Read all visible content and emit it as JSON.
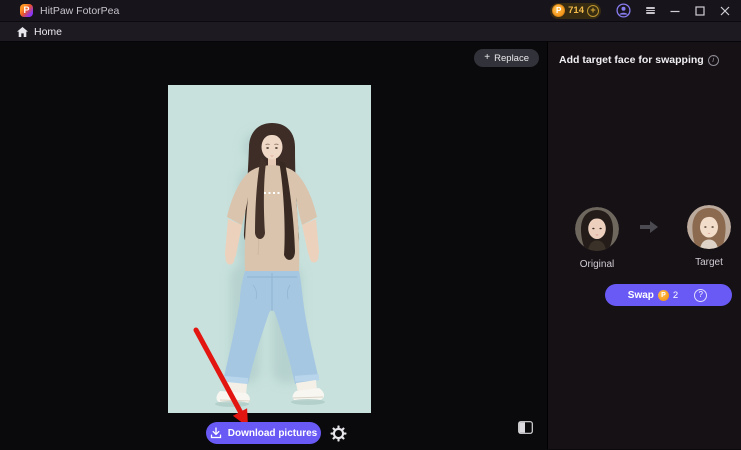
{
  "titlebar": {
    "app_name": "HitPaw FotorPea",
    "logo_letter": "P",
    "coin_letter": "P",
    "coin_count": "714",
    "plus": "+"
  },
  "nav": {
    "home_label": "Home"
  },
  "canvas": {
    "replace_button": {
      "plus": "+",
      "label": "Replace"
    },
    "download_button": {
      "label": "Download pictures"
    }
  },
  "panel": {
    "title": "Add target face for swapping",
    "info": "i",
    "original_label": "Original",
    "target_label": "Target",
    "swap_button": {
      "label": "Swap",
      "coin_letter": "P",
      "cost": "2",
      "help": "?"
    }
  },
  "colors": {
    "accent_purple": "#6a5af5",
    "coin_orange": "#f59a1c",
    "arrow_red": "#e31510",
    "photo_background_mint": "#c8e1dd",
    "titlebar_bg": "#18141c",
    "canvas_bg": "#0a0a0c",
    "panel_bg": "#151115"
  }
}
